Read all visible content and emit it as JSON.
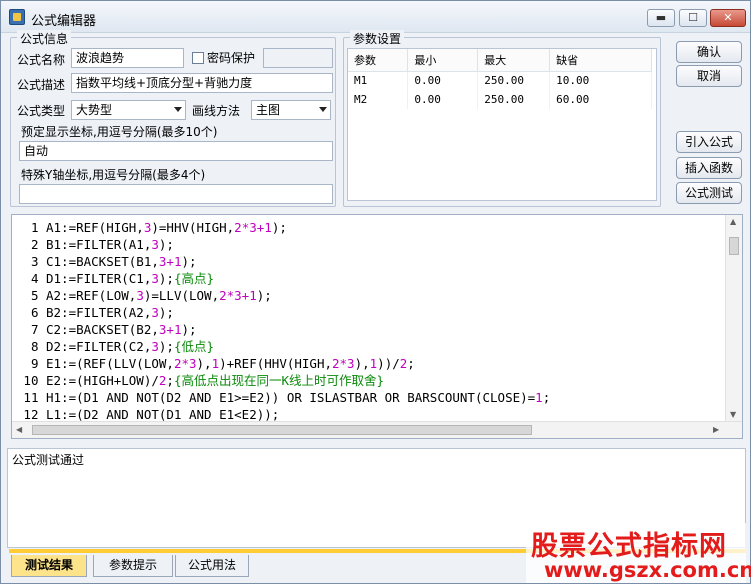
{
  "window": {
    "title": "公式编辑器",
    "min_label": "▬",
    "max_label": "☐",
    "close_label": "✕"
  },
  "formula_info": {
    "group_label": "公式信息",
    "name_label": "公式名称",
    "name_value": "波浪趋势",
    "password_label": "密码保护",
    "password_value": "",
    "desc_label": "公式描述",
    "desc_value": "指数平均线+顶底分型+背驰力度",
    "type_label": "公式类型",
    "type_value": "大势型",
    "draw_label": "画线方法",
    "draw_value": "主图",
    "preset_label": "预定显示坐标,用逗号分隔(最多10个)",
    "preset_value": "自动",
    "special_label": "特殊Y轴坐标,用逗号分隔(最多4个)",
    "special_value": ""
  },
  "params": {
    "group_label": "参数设置",
    "headers": [
      "参数",
      "最小",
      "最大",
      "缺省"
    ],
    "rows": [
      [
        "M1",
        "0.00",
        "250.00",
        "10.00"
      ],
      [
        "M2",
        "0.00",
        "250.00",
        "60.00"
      ]
    ]
  },
  "buttons": {
    "ok": "确认",
    "cancel": "取消",
    "import": "引入公式",
    "insert_func": "插入函数",
    "test": "公式测试"
  },
  "code_lines": [
    {
      "n": "1",
      "html": "A1:=REF(HIGH,<span class=\"num\">3</span>)=HHV(HIGH,<span class=\"num\">2*3+1</span>);"
    },
    {
      "n": "2",
      "html": "B1:=FILTER(A1,<span class=\"num\">3</span>);"
    },
    {
      "n": "3",
      "html": "C1:=BACKSET(B1,<span class=\"num\">3+1</span>);"
    },
    {
      "n": "4",
      "html": "D1:=FILTER(C1,<span class=\"num\">3</span>);<span class=\"cmt\">{高点}</span>"
    },
    {
      "n": "5",
      "html": "A2:=REF(LOW,<span class=\"num\">3</span>)=LLV(LOW,<span class=\"num\">2*3+1</span>);"
    },
    {
      "n": "6",
      "html": "B2:=FILTER(A2,<span class=\"num\">3</span>);"
    },
    {
      "n": "7",
      "html": "C2:=BACKSET(B2,<span class=\"num\">3+1</span>);"
    },
    {
      "n": "8",
      "html": "D2:=FILTER(C2,<span class=\"num\">3</span>);<span class=\"cmt\">{低点}</span>"
    },
    {
      "n": "9",
      "html": "E1:=(REF(LLV(LOW,<span class=\"num\">2*3</span>),<span class=\"num\">1</span>)+REF(HHV(HIGH,<span class=\"num\">2*3</span>),<span class=\"num\">1</span>))/<span class=\"num\">2</span>;"
    },
    {
      "n": "10",
      "html": "E2:=(HIGH+LOW)/<span class=\"num\">2</span>;<span class=\"cmt\">{高低点出现在同一K线上时可作取舍}</span>"
    },
    {
      "n": "11",
      "html": "H1:=(D1 AND NOT(D2 AND E1&gt;=E2)) OR ISLASTBAR OR BARSCOUNT(CLOSE)=<span class=\"num\">1</span>;"
    },
    {
      "n": "12",
      "html": "L1:=(D2 AND NOT(D1 AND E1&lt;E2));"
    }
  ],
  "output": {
    "text": "公式测试通过"
  },
  "tabs": [
    "测试结果",
    "参数提示",
    "公式用法"
  ],
  "watermark": {
    "line1": "股票公式指标网",
    "line2": "www.gszx.com.cn"
  },
  "colors": {
    "accent": "#ffcc33",
    "keyword": "#b000b0",
    "comment": "#0a8a0a",
    "watermark": "#e31b1b"
  }
}
